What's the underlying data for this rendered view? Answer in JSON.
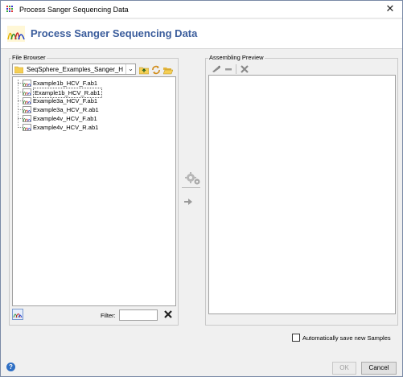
{
  "window": {
    "title": "Process Sanger Sequencing Data",
    "close_glyph": "✕"
  },
  "header": {
    "title": "Process Sanger Sequencing Data",
    "logo_icon": "chromatogram-logo-icon"
  },
  "file_browser": {
    "label": "File Browser",
    "folder": "SeqSphere_Examples_Sanger_HCV/",
    "dropdown_glyph": "⌄",
    "toolbar_icons": [
      "folder-up-icon",
      "refresh-icon",
      "open-folder-icon"
    ],
    "files": [
      "Example1b_HCV_F.ab1",
      "Example1b_HCV_R.ab1",
      "Example3a_HCV_F.ab1",
      "Example3a_HCV_R.ab1",
      "Example4v_HCV_F.ab1",
      "Example4v_HCV_R.ab1"
    ],
    "selected_index": 1,
    "filter_label": "Filter:",
    "filter_value": ""
  },
  "assembling_preview": {
    "label": "Assembling Preview",
    "toolbar_icons": [
      "edit-icon",
      "minus-icon",
      "delete-icon"
    ]
  },
  "footer": {
    "auto_save_label": "Automatically save new Samples",
    "auto_save_checked": false,
    "ok_label": "OK",
    "cancel_label": "Cancel",
    "help_glyph": "?"
  },
  "colors": {
    "title_blue": "#3b5d9c",
    "panel_border": "#c9c9c9"
  }
}
